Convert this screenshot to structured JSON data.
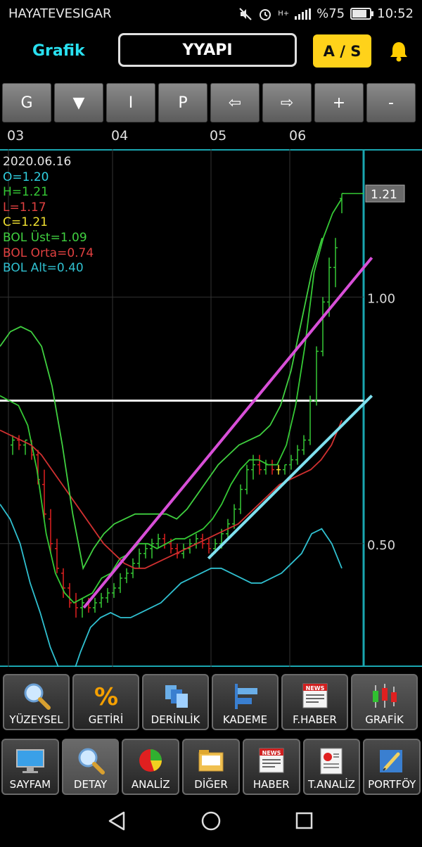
{
  "status": {
    "carrier": "HAYATEVESIGAR",
    "battery": "%75",
    "time": "10:52",
    "network": "H+"
  },
  "header": {
    "title": "Grafik",
    "symbol": "YYAPI",
    "as_label": "A / S"
  },
  "toolbar": [
    {
      "name": "toolbar-g-button",
      "label": "G"
    },
    {
      "name": "toolbar-down-button",
      "label": "▼"
    },
    {
      "name": "toolbar-i-button",
      "label": "I"
    },
    {
      "name": "toolbar-p-button",
      "label": "P"
    },
    {
      "name": "toolbar-left-button",
      "label": "⇦"
    },
    {
      "name": "toolbar-right-button",
      "label": "⇨"
    },
    {
      "name": "toolbar-plus-button",
      "label": "+"
    },
    {
      "name": "toolbar-minus-button",
      "label": "-"
    }
  ],
  "months": [
    "03",
    "04",
    "05",
    "06"
  ],
  "legend": {
    "date": "2020.06.16",
    "open": "O=1.20",
    "high": "H=1.21",
    "low": "L=1.17",
    "close": "C=1.21",
    "bol_upper": "BOL Üst=1.09",
    "bol_mid": "BOL Orta=0.74",
    "bol_lower": "BOL Alt=0.40"
  },
  "colors": {
    "legend_date": "#e6e6e6",
    "open": "#30d0e0",
    "high": "#35c935",
    "low": "#e04040",
    "close": "#f0e030",
    "bol_upper": "#40d040",
    "bol_mid": "#e04040",
    "bol_lower": "#30c0d0",
    "accent": "#29e0f0",
    "as_button": "#ffd21a"
  },
  "chart_data": {
    "type": "line",
    "ylim": [
      0.25,
      1.3
    ],
    "y_ticks": [
      0.5,
      1.0
    ],
    "y_tick_labels": [
      "0.50",
      "1.00"
    ],
    "price_marker": 1.21,
    "price_marker_label": "1.21",
    "grid": true,
    "horizontal_line": 0.79,
    "x": [
      "03",
      "",
      "",
      "",
      "",
      "",
      "",
      "",
      "",
      "",
      "",
      "04",
      "",
      "",
      "",
      "",
      "",
      "",
      "",
      "",
      "",
      "",
      "05",
      "",
      "",
      "",
      "",
      "",
      "",
      "",
      "",
      "",
      "06",
      "",
      "",
      "",
      "",
      "",
      "",
      ""
    ],
    "series": [
      {
        "values": [
          0.8,
          0.79,
          0.78,
          0.74,
          0.65,
          0.52,
          0.44,
          0.4,
          0.38,
          0.39,
          0.4,
          0.43,
          0.44,
          0.47,
          0.48,
          0.5,
          0.5,
          0.49,
          0.5,
          0.51,
          0.51,
          0.52,
          0.53,
          0.55,
          0.58,
          0.62,
          0.65,
          0.67,
          0.67,
          0.66,
          0.66,
          0.7,
          0.78,
          0.9,
          1.05,
          1.12,
          1.17,
          1.2
        ]
      },
      {
        "values": [
          0.73,
          0.72,
          0.71,
          0.7,
          0.68,
          0.65,
          0.62,
          0.59,
          0.56,
          0.53,
          0.5,
          0.48,
          0.46,
          0.45,
          0.45,
          0.46,
          0.47,
          0.48,
          0.49,
          0.5,
          0.51,
          0.52,
          0.53,
          0.54,
          0.56,
          0.58,
          0.6,
          0.62,
          0.63,
          0.64,
          0.65,
          0.67,
          0.7,
          0.75
        ]
      },
      {
        "values": [
          0.9,
          0.93,
          0.94,
          0.93,
          0.9,
          0.82,
          0.7,
          0.56,
          0.45,
          0.49,
          0.52,
          0.54,
          0.55,
          0.56,
          0.56,
          0.56,
          0.56,
          0.55,
          0.57,
          0.6,
          0.63,
          0.66,
          0.68,
          0.7,
          0.71,
          0.72,
          0.74,
          0.78,
          0.85,
          0.95,
          1.05,
          1.12
        ]
      },
      {
        "values": [
          0.58,
          0.55,
          0.5,
          0.42,
          0.36,
          0.29,
          0.24,
          0.22,
          0.28,
          0.33,
          0.35,
          0.36,
          0.35,
          0.35,
          0.36,
          0.37,
          0.38,
          0.4,
          0.42,
          0.43,
          0.44,
          0.45,
          0.45,
          0.44,
          0.43,
          0.42,
          0.42,
          0.43,
          0.44,
          0.46,
          0.48,
          0.52,
          0.53,
          0.5,
          0.45
        ]
      }
    ],
    "candles": [
      {
        "o": 0.7,
        "h": 0.72,
        "l": 0.68,
        "c": 0.71
      },
      {
        "o": 0.71,
        "h": 0.72,
        "l": 0.69,
        "c": 0.7
      },
      {
        "o": 0.7,
        "h": 0.71,
        "l": 0.68,
        "c": 0.71
      },
      {
        "o": 0.7,
        "h": 0.71,
        "l": 0.67,
        "c": 0.68
      },
      {
        "o": 0.68,
        "h": 0.69,
        "l": 0.62,
        "c": 0.63
      },
      {
        "o": 0.62,
        "h": 0.65,
        "l": 0.55,
        "c": 0.56
      },
      {
        "o": 0.55,
        "h": 0.57,
        "l": 0.48,
        "c": 0.5
      },
      {
        "o": 0.49,
        "h": 0.51,
        "l": 0.44,
        "c": 0.45
      },
      {
        "o": 0.44,
        "h": 0.45,
        "l": 0.39,
        "c": 0.41
      },
      {
        "o": 0.41,
        "h": 0.42,
        "l": 0.37,
        "c": 0.38
      },
      {
        "o": 0.38,
        "h": 0.4,
        "l": 0.35,
        "c": 0.37
      },
      {
        "o": 0.37,
        "h": 0.39,
        "l": 0.35,
        "c": 0.38
      },
      {
        "o": 0.38,
        "h": 0.39,
        "l": 0.36,
        "c": 0.37
      },
      {
        "o": 0.37,
        "h": 0.39,
        "l": 0.36,
        "c": 0.38
      },
      {
        "o": 0.38,
        "h": 0.4,
        "l": 0.37,
        "c": 0.39
      },
      {
        "o": 0.39,
        "h": 0.41,
        "l": 0.38,
        "c": 0.4
      },
      {
        "o": 0.4,
        "h": 0.42,
        "l": 0.39,
        "c": 0.41
      },
      {
        "o": 0.41,
        "h": 0.44,
        "l": 0.4,
        "c": 0.43
      },
      {
        "o": 0.43,
        "h": 0.45,
        "l": 0.42,
        "c": 0.44
      },
      {
        "o": 0.44,
        "h": 0.47,
        "l": 0.43,
        "c": 0.46
      },
      {
        "o": 0.46,
        "h": 0.49,
        "l": 0.45,
        "c": 0.48
      },
      {
        "o": 0.48,
        "h": 0.5,
        "l": 0.47,
        "c": 0.49
      },
      {
        "o": 0.49,
        "h": 0.51,
        "l": 0.47,
        "c": 0.5
      },
      {
        "o": 0.5,
        "h": 0.52,
        "l": 0.49,
        "c": 0.51
      },
      {
        "o": 0.51,
        "h": 0.52,
        "l": 0.49,
        "c": 0.5
      },
      {
        "o": 0.5,
        "h": 0.51,
        "l": 0.48,
        "c": 0.49
      },
      {
        "o": 0.49,
        "h": 0.5,
        "l": 0.47,
        "c": 0.48
      },
      {
        "o": 0.48,
        "h": 0.5,
        "l": 0.47,
        "c": 0.49
      },
      {
        "o": 0.49,
        "h": 0.51,
        "l": 0.48,
        "c": 0.5
      },
      {
        "o": 0.5,
        "h": 0.52,
        "l": 0.49,
        "c": 0.51
      },
      {
        "o": 0.51,
        "h": 0.52,
        "l": 0.49,
        "c": 0.5
      },
      {
        "o": 0.5,
        "h": 0.51,
        "l": 0.48,
        "c": 0.49
      },
      {
        "o": 0.49,
        "h": 0.51,
        "l": 0.48,
        "c": 0.5
      },
      {
        "o": 0.5,
        "h": 0.53,
        "l": 0.49,
        "c": 0.52
      },
      {
        "o": 0.52,
        "h": 0.55,
        "l": 0.51,
        "c": 0.54
      },
      {
        "o": 0.54,
        "h": 0.58,
        "l": 0.53,
        "c": 0.57
      },
      {
        "o": 0.57,
        "h": 0.62,
        "l": 0.56,
        "c": 0.61
      },
      {
        "o": 0.61,
        "h": 0.66,
        "l": 0.6,
        "c": 0.65
      },
      {
        "o": 0.65,
        "h": 0.68,
        "l": 0.63,
        "c": 0.66
      },
      {
        "o": 0.66,
        "h": 0.68,
        "l": 0.64,
        "c": 0.65
      },
      {
        "o": 0.65,
        "h": 0.67,
        "l": 0.64,
        "c": 0.66
      },
      {
        "o": 0.66,
        "h": 0.67,
        "l": 0.64,
        "c": 0.65
      },
      {
        "o": 0.65,
        "h": 0.66,
        "l": 0.64,
        "c": 0.65
      },
      {
        "o": 0.65,
        "h": 0.66,
        "l": 0.64,
        "c": 0.66
      },
      {
        "o": 0.66,
        "h": 0.68,
        "l": 0.65,
        "c": 0.67
      },
      {
        "o": 0.67,
        "h": 0.7,
        "l": 0.66,
        "c": 0.69
      },
      {
        "o": 0.69,
        "h": 0.72,
        "l": 0.68,
        "c": 0.71
      },
      {
        "o": 0.71,
        "h": 0.8,
        "l": 0.7,
        "c": 0.79
      },
      {
        "o": 0.79,
        "h": 0.9,
        "l": 0.78,
        "c": 0.89
      },
      {
        "o": 0.89,
        "h": 1.0,
        "l": 0.88,
        "c": 0.99
      },
      {
        "o": 0.99,
        "h": 1.08,
        "l": 0.96,
        "c": 1.06
      },
      {
        "o": 1.06,
        "h": 1.12,
        "l": 1.02,
        "c": 1.1
      },
      {
        "o": 1.2,
        "h": 1.21,
        "l": 1.17,
        "c": 1.21
      }
    ],
    "trend_lines": [
      {
        "color": "#d84fd8",
        "from": [
          8,
          0.37
        ],
        "to": [
          38,
          1.08
        ]
      },
      {
        "color": "#7fe0ef",
        "from": [
          22,
          0.47
        ],
        "to": [
          38,
          0.8
        ]
      }
    ]
  },
  "tabs_top": [
    {
      "name": "tab-yuzeysel",
      "label": "YÜZEYSEL",
      "icon": "magnifier-icon"
    },
    {
      "name": "tab-getiri",
      "label": "GETİRİ",
      "icon": "percent-icon"
    },
    {
      "name": "tab-derinlik",
      "label": "DERİNLİK",
      "icon": "depth-icon"
    },
    {
      "name": "tab-kademe",
      "label": "KADEME",
      "icon": "kademe-icon"
    },
    {
      "name": "tab-fhaber",
      "label": "F.HABER",
      "icon": "news-icon"
    },
    {
      "name": "tab-grafik",
      "label": "GRAFİK",
      "icon": "candlestick-icon"
    }
  ],
  "tabs_bottom": [
    {
      "name": "nav-sayfam",
      "label": "SAYFAM",
      "icon": "monitor-icon"
    },
    {
      "name": "nav-detay",
      "label": "DETAY",
      "icon": "magnifier-icon"
    },
    {
      "name": "nav-analiz",
      "label": "ANALİZ",
      "icon": "pie-chart-icon"
    },
    {
      "name": "nav-diger",
      "label": "DİĞER",
      "icon": "folder-icon"
    },
    {
      "name": "nav-haber",
      "label": "HABER",
      "icon": "news-icon"
    },
    {
      "name": "nav-tanaliz",
      "label": "T.ANALİZ",
      "icon": "report-icon"
    },
    {
      "name": "nav-portfoy",
      "label": "PORTFÖY",
      "icon": "pen-icon"
    }
  ]
}
